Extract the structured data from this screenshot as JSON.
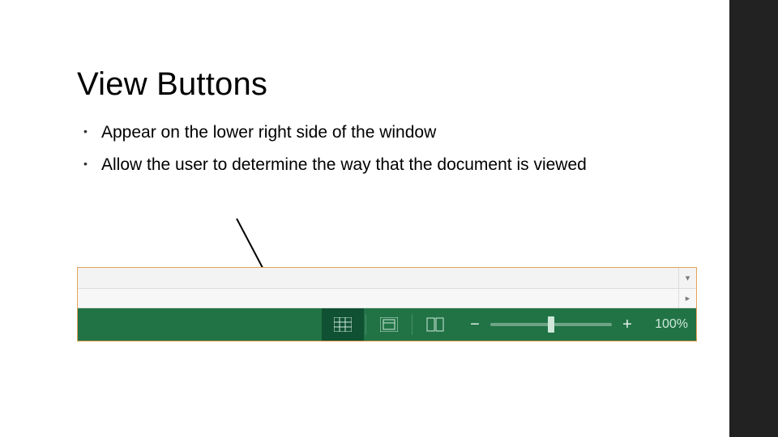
{
  "slide": {
    "title": "View Buttons",
    "bullets": [
      "Appear on the lower right side of the window",
      "Allow the user to determine the way that the document is viewed"
    ]
  },
  "statusbar": {
    "zoom_out_label": "−",
    "zoom_in_label": "+",
    "zoom_pct": "100%",
    "slider_position_pct": 50
  },
  "icons": {
    "normal_view": "normal-view-icon",
    "page_layout_view": "page-layout-view-icon",
    "page_break_view": "page-break-view-icon",
    "scroll_down": "▾",
    "scroll_right": "▸"
  }
}
